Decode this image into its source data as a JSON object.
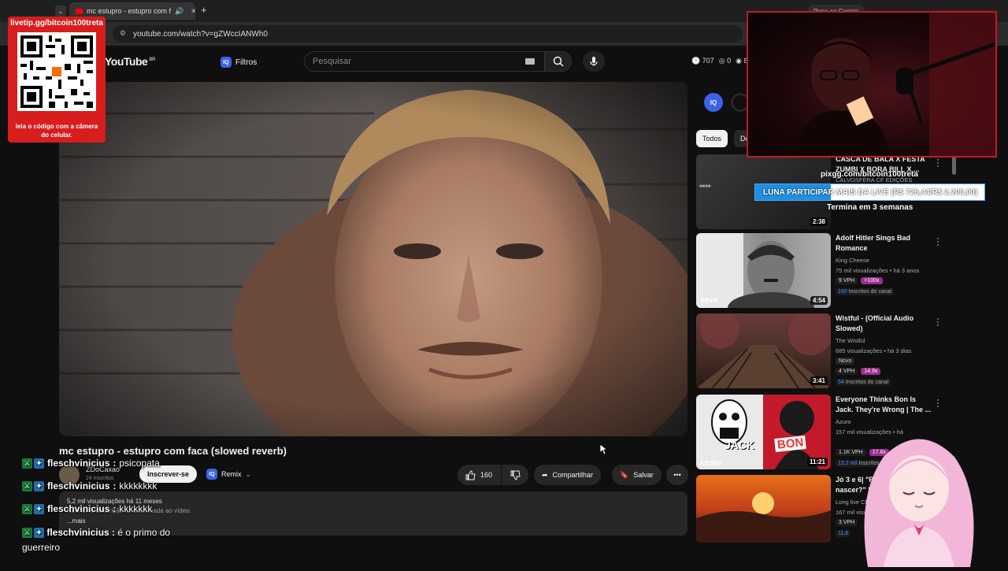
{
  "browser": {
    "tab_title": "mc estupro - estupro com f",
    "new_tab_symbol": "+",
    "url": "youtube.com/watch?v=gZWccIANWh0",
    "gemini_label": "Peça ao Gemini"
  },
  "youtube": {
    "logo": "YouTube",
    "region": "BR",
    "filters_label": "Filtros",
    "search_placeholder": "Pesquisar",
    "stats": [
      "707",
      "0",
      "8"
    ]
  },
  "video": {
    "title": "mc estupro - estupro com faca (slowed reverb)",
    "channel": "ZDoCaxao",
    "subscribers": "24 inscritos",
    "subscribe_label": "Inscrever-se",
    "remix_label": "Remix",
    "likes": "160",
    "share_label": "Compartilhar",
    "save_label": "Salvar",
    "views_line": "5,2 mil visualizações  há 11 meses",
    "description": "Nenhuma descrição foi adicionada ao vídeo.",
    "more_label": "...mais"
  },
  "sidebar": {
    "chips": [
      "Todos",
      "De"
    ],
    "recommendations": [
      {
        "title": "CASCA DE BALA X FESTA ZUMBI X BORA BILL X ...",
        "channel": "CALVOSFERA CF EDIÇÕES",
        "meta": "",
        "duration": "2:38"
      },
      {
        "title": "Adolf Hitler Sings Bad Romance",
        "channel": "King Cheese",
        "meta": "75 mil visualizações • há 3 anos",
        "vph": "9 VPH",
        "badge": ">100x",
        "insc_count": "160",
        "insc_label": "Inscritos do canal",
        "duration": "4:54",
        "brand": "vevo"
      },
      {
        "title": "Wistful - (Official Audio Slowed)",
        "channel": "The Wistful",
        "meta": "685 visualizações • há 3 dias",
        "novo": "Novo",
        "vph": "4 VPH",
        "badge": "14.9x",
        "insc_count": "54",
        "insc_label": "Inscritos do canal",
        "duration": "3:41"
      },
      {
        "title": "Everyone Thinks Bon Is Jack. They're Wrong | The ...",
        "channel": "Azuro",
        "meta": "157 mil visualizações • há",
        "vph": "1.1K VPH",
        "badge": "17.6x",
        "insc_count": "13,2 mil",
        "insc_label": "Inscritos",
        "duration": "11:21",
        "thumb_text": "JACK",
        "thumb_text2": "BON",
        "thumb_brand": "AZURO"
      },
      {
        "title": "Jó 3 e 6| \"Por q... ao nascer?\" |",
        "channel": "Long live Chris...",
        "meta": "167 mil visu...",
        "vph": "3 VPH",
        "insc_count": "11,6",
        "duration": ""
      }
    ]
  },
  "overlay": {
    "qr_url": "livetip.gg/bitcoin100treta",
    "qr_note": "leia o código com a câmera do celular.",
    "donate_url": "pixgg.com/bitcoin100treta",
    "donate_goal": "LUNA PARTICIPAR MAIS DA LIVE (R$ 726,44/R$ 2.200,00)",
    "donate_progress": 0.33,
    "donate_ends": "Termina em 3 semanas",
    "chat": [
      {
        "user": "fleschvinicius",
        "msg": "psicopata"
      },
      {
        "user": "fleschvinicius",
        "msg": "kkkkkkkk"
      },
      {
        "user": "fleschvinicius",
        "msg": "kkkkkkk"
      },
      {
        "user": "fleschvinicius",
        "msg": "é o primo do guerreiro"
      }
    ]
  },
  "colors": {
    "accent_red": "#d81d1d",
    "iq_blue": "#3b63e8",
    "donate_blue": "#1f8fe0",
    "vph_purple": "#9b2c90"
  }
}
